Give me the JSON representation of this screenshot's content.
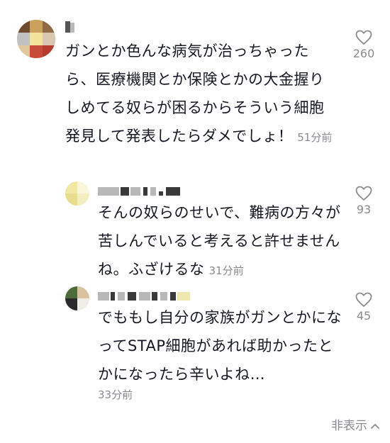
{
  "comments": [
    {
      "text": "ガンとか色んな病気が治っちゃったら、医療機関とか保険とかの大金握りしめてる奴らが困るからそういう細胞発見して発表したらダメでしょ！",
      "time": "51分前",
      "likes": "260",
      "avatar_colors": [
        "#6e4a2e",
        "#caa15c",
        "#e0c79a",
        "#c0c0c0",
        "#f2e39a",
        "#c84a3a",
        "#b63c30",
        "#d9c6b0",
        "#8f6a44"
      ]
    },
    {
      "text": "そんの奴らのせいで、難病の方々が苦しんでいると考えると許せませんね。ふざけるな",
      "time": "31分前",
      "likes": "93",
      "avatar_colors": [
        "#f1e9a3",
        "#e8dd8e",
        "#f4efc0",
        "#faf6dc"
      ]
    },
    {
      "text": "でももし自分の家族がガンとかになってSTAP細胞があれば助かったとかになったら辛いよね…",
      "time": "33分前",
      "likes": "45",
      "avatar_colors": [
        "#4e6b3c",
        "#d8c2a0",
        "#2a2a2a",
        "#f0ede6"
      ]
    }
  ],
  "hide_label": "非表示",
  "colors": {
    "text": "#161823",
    "muted": "#8a8b91",
    "background": "#ffffff"
  },
  "icons": {
    "like": "heart-outline-icon",
    "expand": "chevron-up-icon"
  }
}
